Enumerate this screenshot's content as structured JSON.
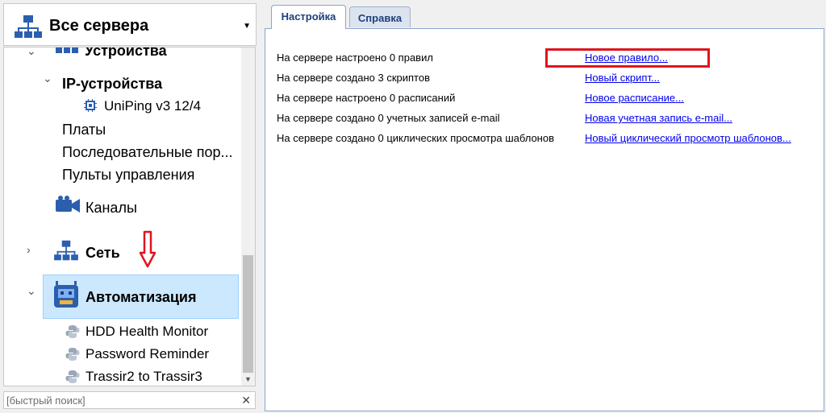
{
  "server_selector": {
    "title": "Все сервера"
  },
  "tree": {
    "items": [
      {
        "label": "Устройства"
      },
      {
        "label": "IP-устройства"
      },
      {
        "label": "UniPing v3 12/4"
      },
      {
        "label": "Платы"
      },
      {
        "label": "Последовательные пор..."
      },
      {
        "label": "Пульты управления"
      },
      {
        "label": "Каналы"
      },
      {
        "label": "Сеть"
      },
      {
        "label": "Автоматизация"
      },
      {
        "label": "HDD Health Monitor"
      },
      {
        "label": "Password Reminder"
      },
      {
        "label": "Trassir2 to Trassir3"
      }
    ]
  },
  "search": {
    "placeholder": "[быстрый поиск]"
  },
  "tabs": [
    {
      "label": "Настройка"
    },
    {
      "label": "Справка"
    }
  ],
  "settings": {
    "rows": [
      {
        "text": "На сервере настроено 0 правил",
        "link": "Новое правило..."
      },
      {
        "text": "На сервере создано 3 скриптов",
        "link": "Новый скрипт..."
      },
      {
        "text": "На сервере настроено 0 расписаний",
        "link": "Новое расписание..."
      },
      {
        "text": "На сервере создано 0 учетных записей e-mail",
        "link": "Новая учетная запись e-mail..."
      },
      {
        "text": "На сервере создано 0 циклических просмотра шаблонов",
        "link": "Новый циклический просмотр шаблонов..."
      }
    ]
  },
  "colors": {
    "highlight": "#e0141e",
    "link": "#0000ee",
    "selection": "#cce8ff"
  }
}
